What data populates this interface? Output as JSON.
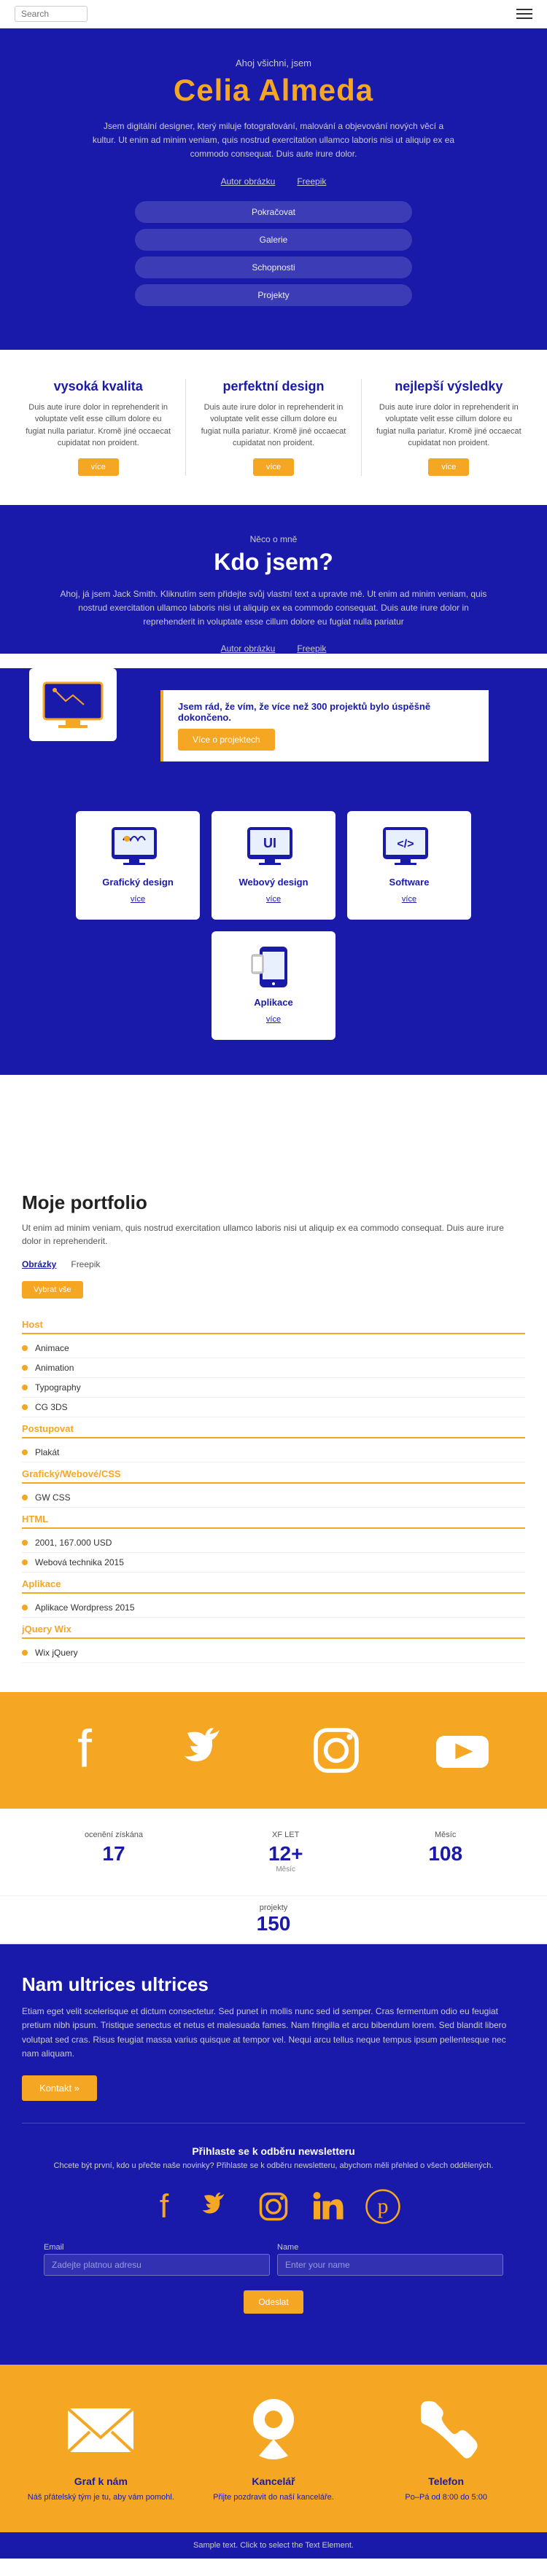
{
  "nav": {
    "search_placeholder": "Search",
    "hamburger_label": "Menu"
  },
  "hero": {
    "subtitle": "Ahoj všichni, jsem",
    "title": "Celia Almeda",
    "description": "Jsem digitální designer, který miluje fotografování, malování a objevování nových věcí a kultur. Ut enim ad minim veniam, quis nostrud exercitation ullamco laboris nisi ut aliquip ex ea commodo consequat. Duis aute irure dolor.",
    "tab_about": "Autor obrázku",
    "tab_profile": "Freepik",
    "pill1": "Pokračovat",
    "pill2": "Galerie",
    "pill3": "Schopnosti",
    "pill4": "Projekty"
  },
  "features": {
    "items": [
      {
        "title": "vysoká kvalita",
        "desc": "Duis aute irure dolor in reprehenderit in voluptate velit esse cillum dolore eu fugiat nulla pariatur. Kromě jiné occaecat cupidatat non proident.",
        "btn": "více"
      },
      {
        "title": "perfektní design",
        "desc": "Duis aute irure dolor in reprehenderit in voluptate velit esse cillum dolore eu fugiat nulla pariatur. Kromě jiné occaecat cupidatat non proident.",
        "btn": "více"
      },
      {
        "title": "nejlepší výsledky",
        "desc": "Duis aute irure dolor in reprehenderit in voluptate velit esse cillum dolore eu fugiat nulla pariatur. Kromě jiné occaecat cupidatat non proident.",
        "btn": "více"
      }
    ]
  },
  "about": {
    "label": "Něco o mně",
    "title": "Kdo jsem?",
    "description": "Ahoj, já jsem Jack Smith. Kliknutím sem přidejte svůj vlastní text a upravte mě. Ut enim ad minim veniam, quis nostrud exercitation ullamco laboris nisi ut aliquip ex ea commodo consequat. Duis aute irure dolor in reprehenderit in voluptate esse cillum dolore eu fugiat nulla pariatur",
    "tab_about": "Autor obrázku",
    "tab_profile": "Freepik",
    "quote": "Jsem rád, že vím, že více než 300 projektů bylo úspěšně dokončeno.",
    "cta_btn": "Více o projektech",
    "services": [
      {
        "name": "Grafický design",
        "link": "více"
      },
      {
        "name": "Webový design",
        "link": "více"
      },
      {
        "name": "Software",
        "link": "více"
      },
      {
        "name": "Aplikace",
        "link": "více"
      }
    ]
  },
  "portfolio": {
    "title": "Moje portfolio",
    "description": "Ut enim ad minim veniam, quis nostrud exercitation ullamco laboris nisi ut aliquip ex ea commodo consequat. Duis aure irure dolor in reprehenderit.",
    "tab_projects": "Obrázky",
    "tab_profile": "Freepik",
    "filter_btn": "Vybrat vše",
    "sections": [
      {
        "header": "Host",
        "items": [
          {
            "label": "Animace",
            "value": ""
          },
          {
            "label": "Animation",
            "value": ""
          },
          {
            "label": "Typography",
            "value": ""
          },
          {
            "label": "CG 3DS",
            "value": ""
          }
        ]
      },
      {
        "header": "Postupovat",
        "items": [
          {
            "label": "Plakát",
            "value": ""
          }
        ]
      },
      {
        "header": "Grafický/Webové/CSS",
        "items": [
          {
            "label": "GW CSS",
            "value": ""
          }
        ]
      },
      {
        "header": "HTML",
        "items": [
          {
            "label": "2001, 167.000 USD",
            "value": ""
          },
          {
            "label": "Webová technika 2015",
            "value": ""
          }
        ]
      },
      {
        "header": "Aplikace",
        "items": [
          {
            "label": "Aplikace Wordpress 2015",
            "value": ""
          }
        ]
      },
      {
        "header": "jQuery Wix",
        "items": [
          {
            "label": "Wix jQuery",
            "value": ""
          }
        ]
      }
    ]
  },
  "social": {
    "icons": [
      "facebook",
      "twitter",
      "instagram",
      "youtube"
    ]
  },
  "stats": {
    "items": [
      {
        "label": "ocenění získána",
        "value": "17",
        "sublabel": ""
      },
      {
        "label": "XF LET",
        "value": "12+",
        "sublabel": "Měsíc"
      },
      {
        "label": "Měsíc",
        "value": "108",
        "sublabel": ""
      }
    ],
    "projects_label": "projekty",
    "projects_value": "150"
  },
  "cta": {
    "title": "Nam ultrices ultrices",
    "description": "Etiam eget velit scelerisque et dictum consectetur. Sed punet in mollis nunc sed id semper. Cras fermentum odio eu feugiat pretium nibh ipsum. Tristique senectus et netus et malesuada fames. Nam fringilla et arcu bibendum lorem. Sed blandit libero volutpat sed cras. Risus feugiat massa varius quisque at tempor vel. Nequi arcu tellus neque tempus ipsum pellentesque nec nam aliquam.",
    "btn": "Kontakt »"
  },
  "newsletter": {
    "title": "Přihlaste se k odběru newsletteru",
    "description": "Chcete být první, kdo u přečte naše novinky? Přihlaste se k odběru newsletteru, abychom měli přehled o všech oddělených.",
    "social_icons": [
      "facebook",
      "twitter",
      "instagram",
      "linkedin",
      "pinterest"
    ],
    "email_label": "Email",
    "email_placeholder": "Zadejte platnou adresu",
    "name_label": "Name",
    "name_placeholder": "Enter your name",
    "submit_btn": "Odeslat"
  },
  "contact": {
    "items": [
      {
        "icon": "envelope",
        "title": "Graf k nám",
        "desc": "Náš přátelský tým je tu, aby vám pomohl."
      },
      {
        "icon": "location",
        "title": "Kancelář",
        "desc": "Přijte pozdravit do naší kanceláře."
      },
      {
        "icon": "phone",
        "title": "Telefon",
        "desc": "Po–Pá od 8:00 do 5:00"
      }
    ]
  },
  "footer": {
    "text": "Sample text. Click to select the Text Element."
  }
}
